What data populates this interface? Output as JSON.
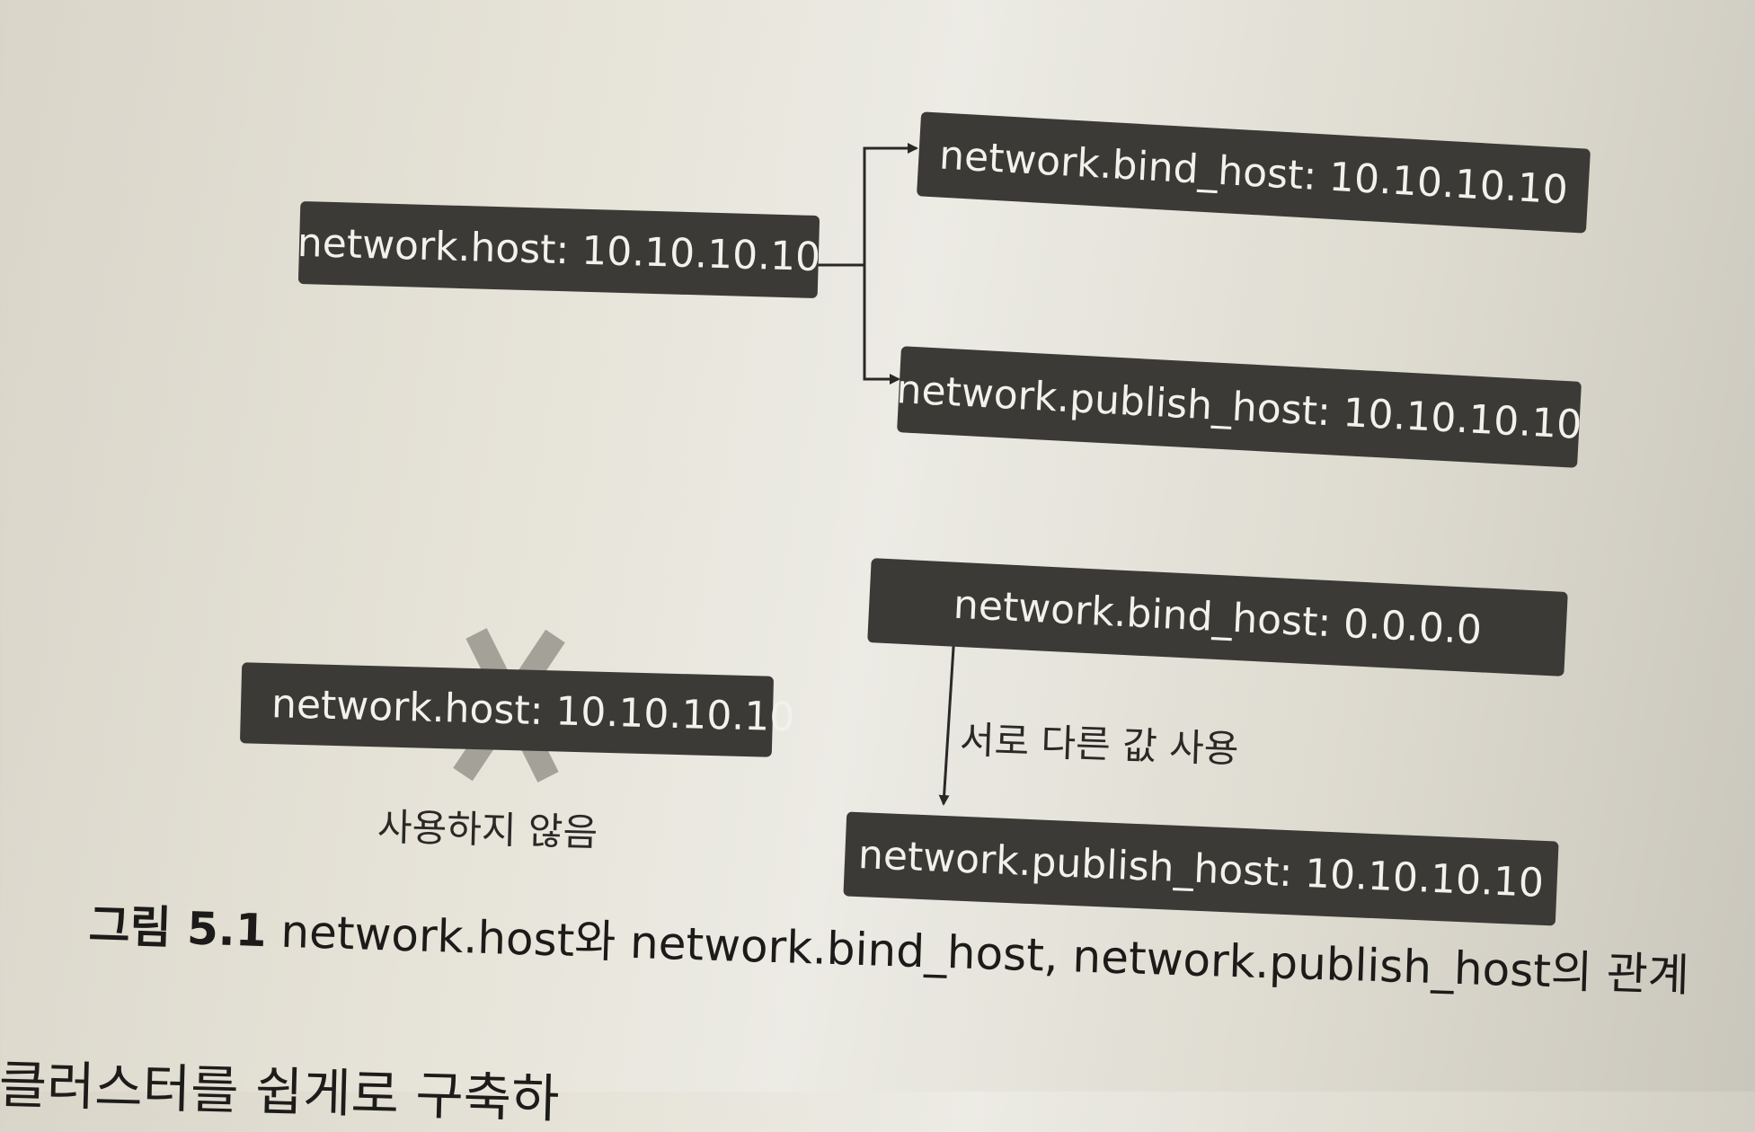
{
  "diagram": {
    "top": {
      "source_box": "network.host: 10.10.10.10",
      "bind_box": "network.bind_host: 10.10.10.10",
      "publish_box": "network.publish_host: 10.10.10.10"
    },
    "bottom": {
      "source_box": "network.host: 10.10.10.10",
      "source_note": "사용하지 않음",
      "bind_box": "network.bind_host: 0.0.0.0",
      "publish_box": "network.publish_host: 10.10.10.10",
      "arrow_label": "서로 다른 값 사용"
    }
  },
  "caption": {
    "number": "그림 5.1",
    "text": "network.host와 network.bind_host, network.publish_host의 관계"
  },
  "body_text_fragment": "클러스터를 쉽게로 구축하"
}
